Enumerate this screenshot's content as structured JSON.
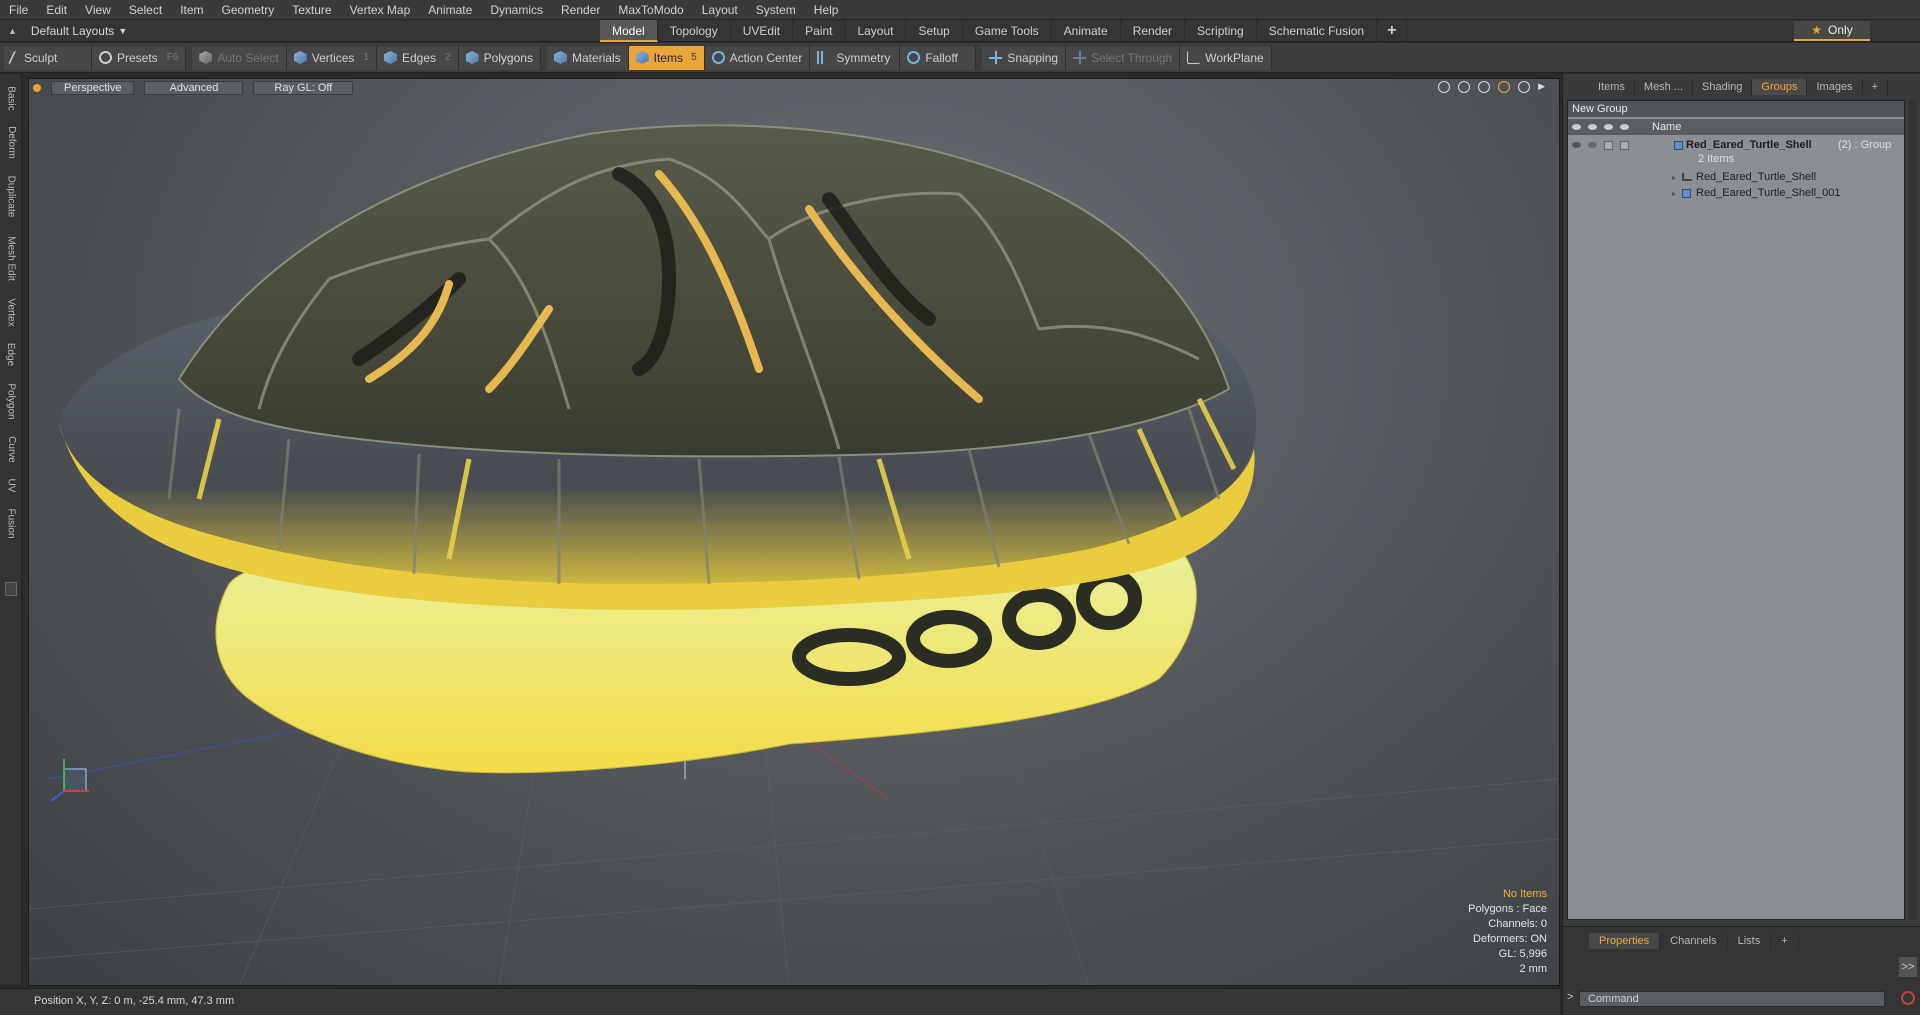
{
  "menu": [
    "File",
    "Edit",
    "View",
    "Select",
    "Item",
    "Geometry",
    "Texture",
    "Vertex Map",
    "Animate",
    "Dynamics",
    "Render",
    "MaxToModo",
    "Layout",
    "System",
    "Help"
  ],
  "layout_selector": "Default Layouts",
  "layout_tabs": [
    "Model",
    "Topology",
    "UVEdit",
    "Paint",
    "Layout",
    "Setup",
    "Game Tools",
    "Animate",
    "Render",
    "Scripting",
    "Schematic Fusion"
  ],
  "layout_tab_add": "+",
  "only_label": "Only",
  "toolbar": {
    "sculpt": "Sculpt",
    "presets": "Presets",
    "presets_hotkey": "F6",
    "auto_select": "Auto Select",
    "vertices": "Vertices",
    "vertices_key": "1",
    "edges": "Edges",
    "edges_key": "2",
    "polygons": "Polygons",
    "materials": "Materials",
    "items": "Items",
    "items_key": "5",
    "action_center": "Action Center",
    "symmetry": "Symmetry",
    "falloff": "Falloff",
    "snapping": "Snapping",
    "select_through": "Select Through",
    "workplane": "WorkPlane"
  },
  "side_tabs": [
    "Basic",
    "Deform",
    "Duplicate",
    "Mesh Edit",
    "Vertex",
    "Edge",
    "Polygon",
    "Curve",
    "UV",
    "Fusion"
  ],
  "viewport": {
    "view": "Perspective",
    "shading": "Advanced",
    "raygl": "Ray GL: Off",
    "info": {
      "items": "No Items",
      "polygons": "Polygons : Face",
      "channels": "Channels: 0",
      "deformers": "Deformers: ON",
      "gl": "GL: 5,996",
      "grid": "2 mm"
    }
  },
  "status": "Position X, Y, Z:  0 m, -25.4 mm, 47.3 mm",
  "right_panel": {
    "tabs": [
      "Items",
      "Mesh ...",
      "Shading",
      "Groups",
      "Images",
      "+"
    ],
    "active_tab": "Groups",
    "new_group": "New Group",
    "col_name": "Name",
    "group_name": "Red_Eared_Turtle_Shell",
    "group_suffix": "(2) : Group",
    "group_count": "2 Items",
    "children": [
      "Red_Eared_Turtle_Shell",
      "Red_Eared_Turtle_Shell_001"
    ],
    "bottom_tabs": [
      "Properties",
      "Channels",
      "Lists",
      "+"
    ],
    "arrow": ">>",
    "command_placeholder": "Command"
  },
  "colors": {
    "accent": "#e8a53a",
    "shell_yellow": "#f3d84a",
    "shell_dark": "#3f4233"
  }
}
